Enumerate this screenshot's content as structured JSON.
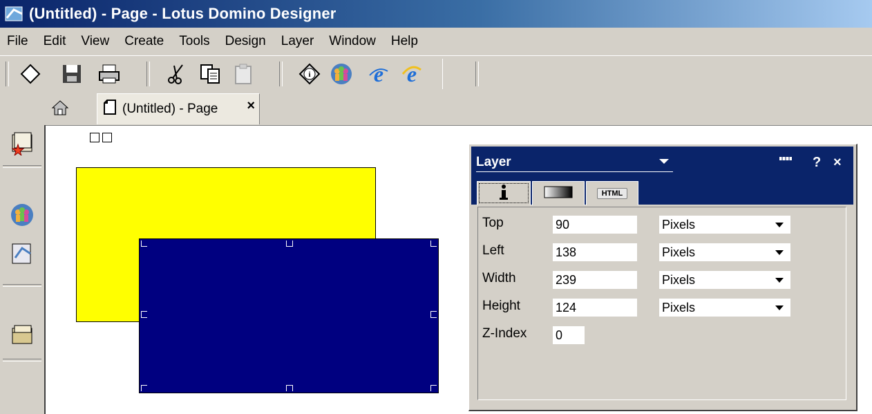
{
  "window": {
    "title": "(Untitled) - Page - Lotus Domino Designer"
  },
  "menu": [
    {
      "label": "File"
    },
    {
      "label": "Edit"
    },
    {
      "label": "View"
    },
    {
      "label": "Create"
    },
    {
      "label": "Tools"
    },
    {
      "label": "Design"
    },
    {
      "label": "Layer"
    },
    {
      "label": "Window"
    },
    {
      "label": "Help"
    }
  ],
  "tabs": {
    "active_label": "(Untitled) - Page",
    "close_glyph": "×"
  },
  "layer_panel": {
    "title": "Layer",
    "help_glyph": "?",
    "close_glyph": "×",
    "html_tab_label": "HTML",
    "rows": [
      {
        "label": "Top",
        "value": "90",
        "unit": "Pixels"
      },
      {
        "label": "Left",
        "value": "138",
        "unit": "Pixels"
      },
      {
        "label": "Width",
        "value": "239",
        "unit": "Pixels"
      },
      {
        "label": "Height",
        "value": "124",
        "unit": "Pixels"
      },
      {
        "label": "Z-Index",
        "value": "0"
      }
    ]
  },
  "colors": {
    "yellow_layer": "#ffff00",
    "blue_layer": "#000080",
    "title_bar": "#0a246a"
  },
  "icons": [
    "app-icon",
    "new-icon",
    "save-icon",
    "print-icon",
    "cut-icon",
    "copy-icon",
    "paste-icon",
    "info-icon",
    "people-icon",
    "browser-preview-icon",
    "ie-icon",
    "home-icon",
    "page-icon",
    "favorites-icon",
    "address-book-icon",
    "designer-icon",
    "folder-icon"
  ]
}
